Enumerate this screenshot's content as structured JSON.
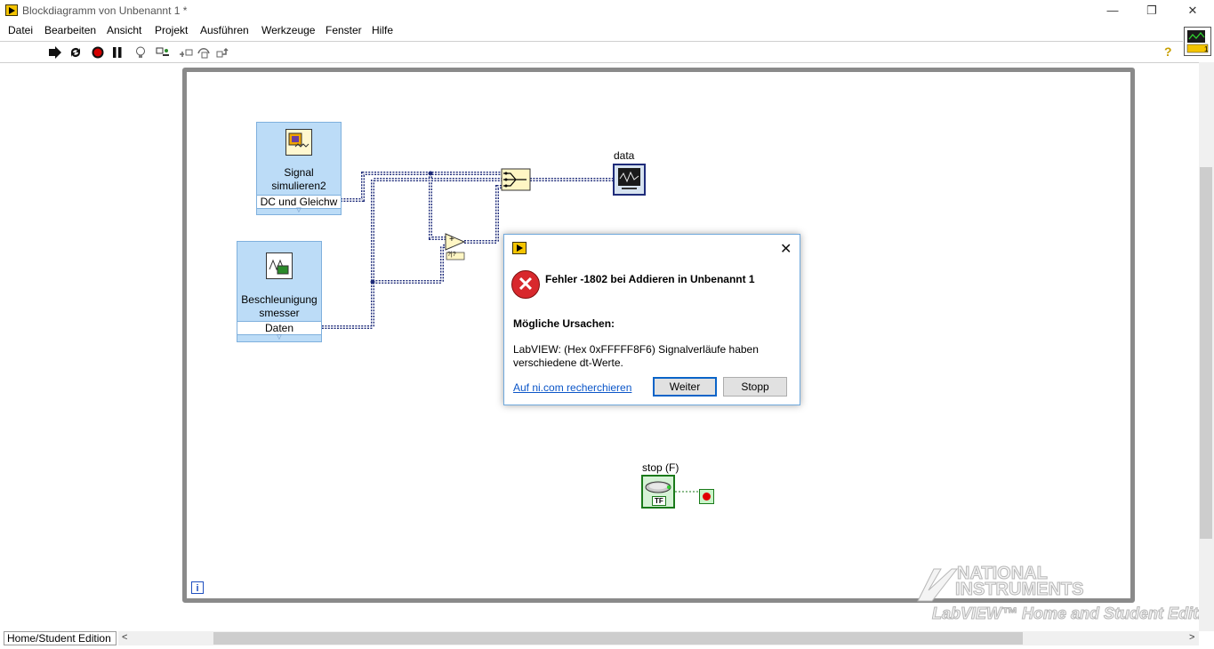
{
  "window": {
    "title": "Blockdiagramm von Unbenannt 1 *",
    "minimize": "—",
    "restore": "❐",
    "close": "✕"
  },
  "menu": [
    "Datei",
    "Bearbeiten",
    "Ansicht",
    "Projekt",
    "Ausführen",
    "Werkzeuge",
    "Fenster",
    "Hilfe"
  ],
  "toolbar": {
    "help": "?",
    "icons": [
      "run-arrow-icon",
      "run-continuously-icon",
      "abort-icon",
      "pause-icon",
      "highlight-execution-icon",
      "retain-wire-values-icon",
      "step-into-icon",
      "step-over-icon",
      "step-out-icon"
    ]
  },
  "diagram": {
    "signal_vi": {
      "line1": "Signal",
      "line2": "simulieren2",
      "terminal": "DC und Gleichw"
    },
    "accel_vi": {
      "line1": "Beschleunigung",
      "line2": "smesser",
      "terminal": "Daten"
    },
    "graph_label": "data",
    "stop_label": "stop (F)",
    "stop_terminal_text": "TF",
    "iteration_label": "i",
    "add_symbol": "+",
    "add_coercion": "?|?"
  },
  "dialog": {
    "heading": "Fehler -1802 bei Addieren in Unbenannt 1",
    "causes_label": "Mögliche Ursachen:",
    "message_line1": "LabVIEW:  (Hex 0xFFFFF8F6) Signalverläufe haben",
    "message_line2": "verschiedene dt-Werte.",
    "link": "Auf ni.com recherchieren",
    "continue_button": "Weiter",
    "stop_button": "Stopp",
    "close": "✕",
    "error_glyph": "✕"
  },
  "status_bar": {
    "edition": "Home/Student Edition",
    "scroll_left": "<",
    "scroll_right": ">"
  },
  "watermark": {
    "line1": "NATIONAL",
    "line2": "INSTRUMENTS",
    "line3": "LabVIEW™ Home and Student Edition"
  },
  "colors": {
    "vi_background": "#bcdcf7",
    "wire_dynamic": "#1f2c7a",
    "wire_boolean": "#1a7a1a",
    "error_red": "#d8282d",
    "link_blue": "#0a55c8"
  }
}
